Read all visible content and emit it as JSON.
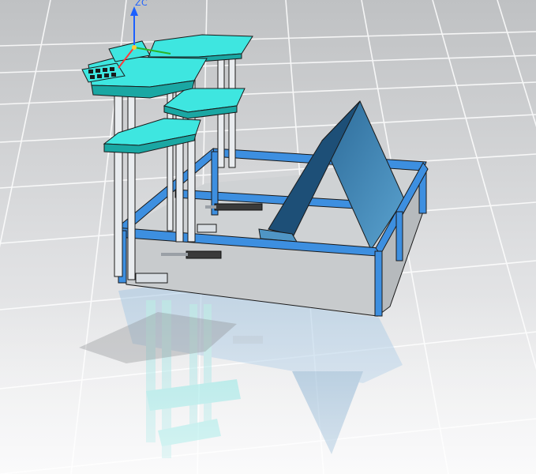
{
  "viewport": {
    "axis_label": "ZC",
    "colors": {
      "floor_top": "#bfc1c3",
      "floor_bottom": "#f2f2f3",
      "grid_line": "#ffffff",
      "frame_blue": "#3d8fe0",
      "frame_blue_dark": "#1f5f9e",
      "shelf_cyan": "#3ee6e0",
      "shelf_cyan_dark": "#1aa7a3",
      "post_gray": "#e9ecef",
      "ramp_blue": "#2f6e9c",
      "ramp_blue_light": "#4f95c4",
      "interior_gray": "#cfd2d4",
      "axis_z": "#1c60ff",
      "axis_x": "#ff3a3a",
      "axis_y": "#2ab52a",
      "outline": "#1a1a1a"
    }
  }
}
